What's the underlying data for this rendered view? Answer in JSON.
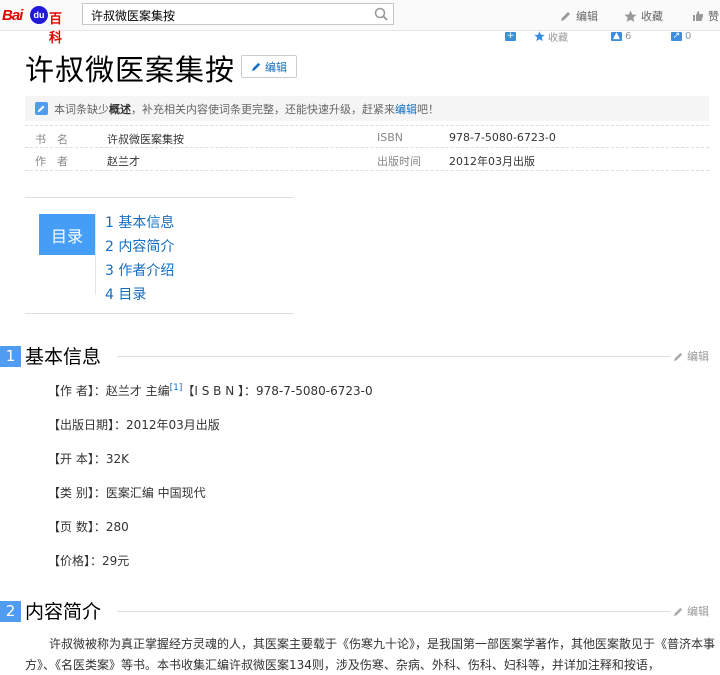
{
  "topbar": {
    "logo_bai": "Bai",
    "logo_du": "du",
    "logo_baike": "百科",
    "search_value": "许叔微医案集按",
    "actions": {
      "edit": "编辑",
      "favorite": "收藏",
      "like": "赞"
    }
  },
  "strip": {
    "favorite": "收藏",
    "count1": "6",
    "count2": "0"
  },
  "header": {
    "title": "许叔微医案集按",
    "edit_label": "编辑"
  },
  "notice": {
    "pre": "本词条缺少",
    "bold": "概述",
    "mid": "，补充相关内容使词条更完整，还能快速升级，赶紧来",
    "link": "编辑",
    "post": "吧！"
  },
  "info": [
    {
      "k1": "书　名",
      "v1": "许叔微医案集按",
      "k2": "ISBN",
      "v2": "978-7-5080-6723-0"
    },
    {
      "k1": "作　者",
      "v1": "赵兰才",
      "k2": "出版时间",
      "v2": "2012年03月出版"
    }
  ],
  "toc": {
    "label": "目录",
    "items": [
      "1  基本信息",
      "2  内容简介",
      "3  作者介绍",
      "4  目录"
    ]
  },
  "sections": [
    {
      "num": "1",
      "title": "基本信息",
      "edit": "编辑"
    },
    {
      "num": "2",
      "title": "内容简介",
      "edit": "编辑"
    }
  ],
  "basic": {
    "author_pre": "【作 者】：赵兰才 主编",
    "ref": "[1]",
    "author_post": "【I S B N 】：978-7-5080-6723-0",
    "date": "【出版日期】：2012年03月出版",
    "format": "【开 本】：32K",
    "category": "【类 别】：医案汇编 中国现代",
    "pages": "【页 数】：280",
    "price": "【价格】：29元"
  },
  "intro": {
    "text": "许叔微被称为真正掌握经方灵魂的人，其医案主要载于《伤寒九十论》，是我国第一部医案学著作，其他医案散见于《普济本事方》、《名医类案》等书。本书收集汇编许叔微医案134则，涉及伤寒、杂病、外科、伤科、妇科等，并详加注释和按语，"
  }
}
